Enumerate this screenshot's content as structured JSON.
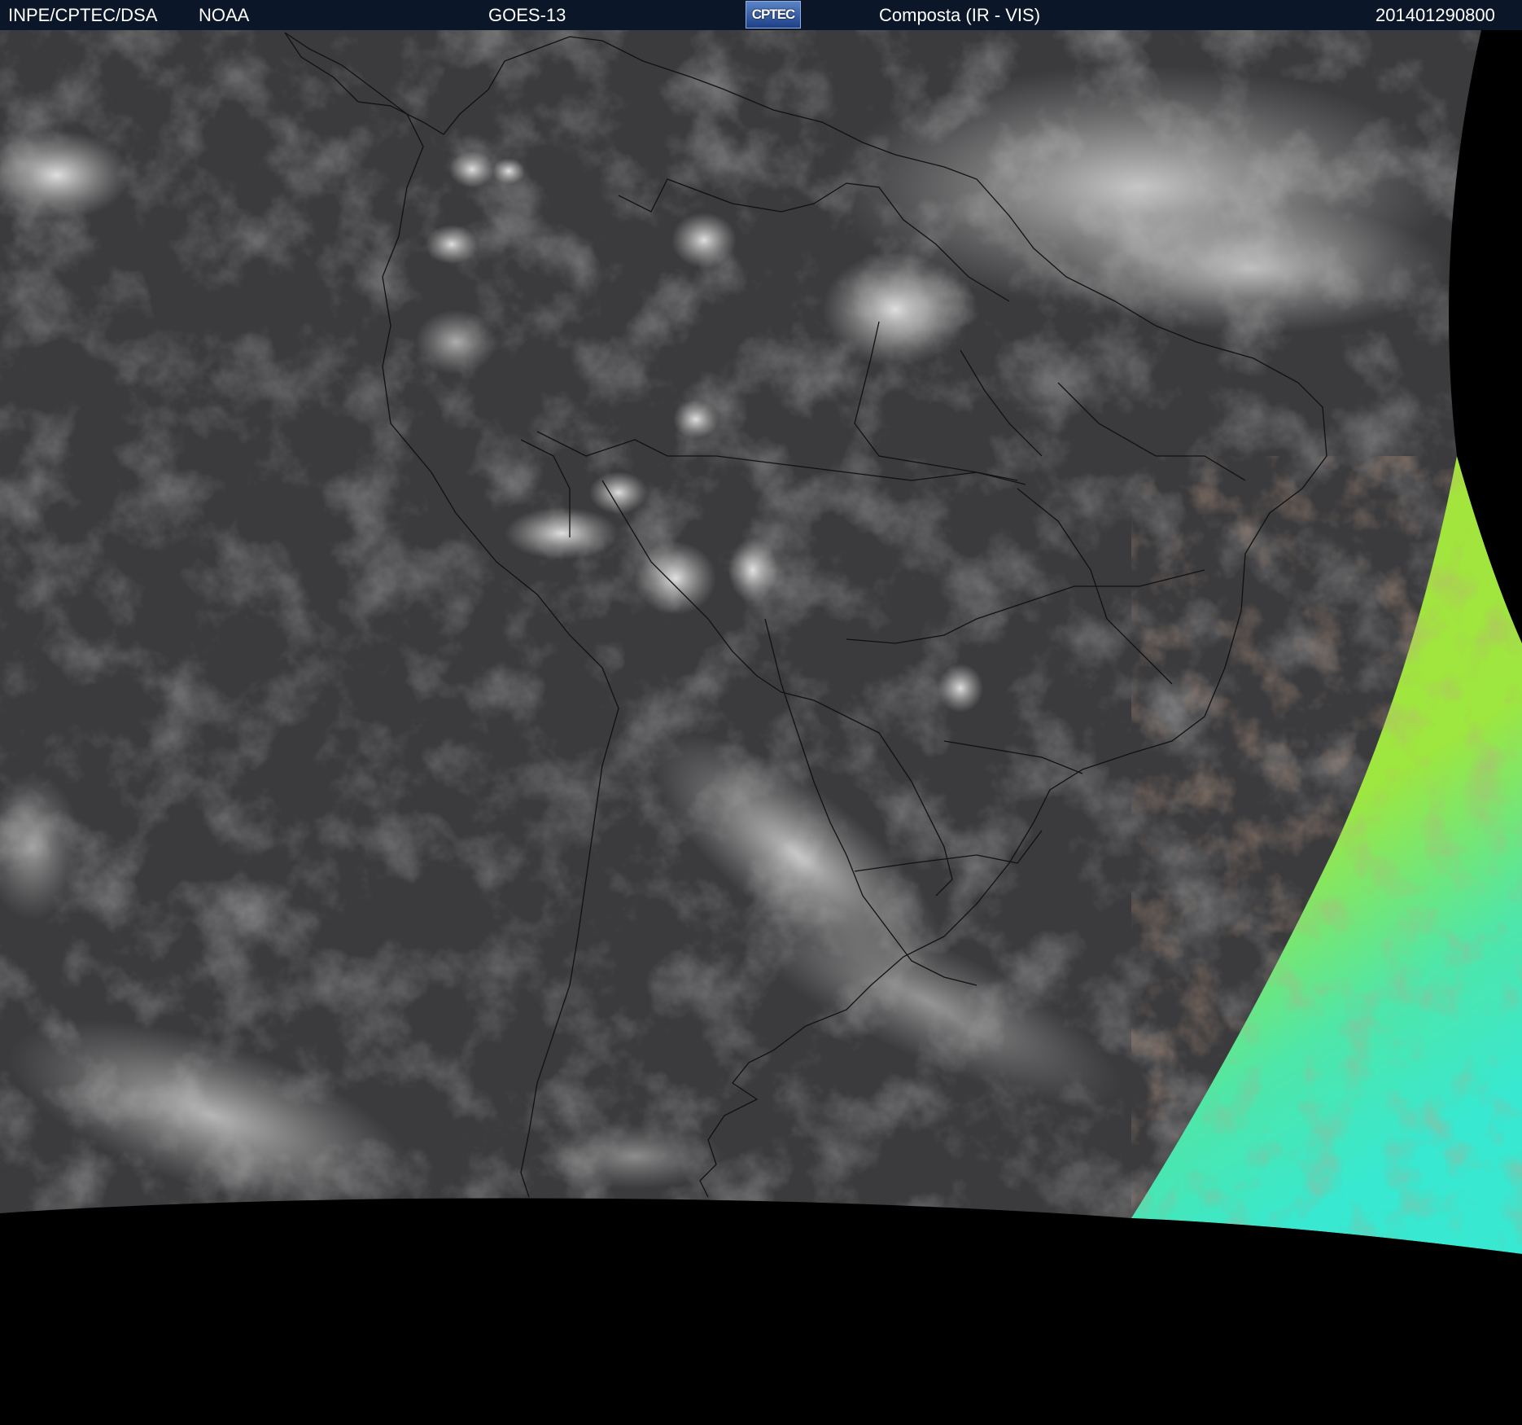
{
  "header": {
    "agency": "INPE/CPTEC/DSA",
    "partner": "NOAA",
    "satellite": "GOES-13",
    "logo_text": "CPTEC",
    "product": "Composta (IR - VIS)",
    "timestamp": "201401290800"
  },
  "colors": {
    "header_bg": "#0b1628",
    "cloud_field": "#3a3a3a",
    "cloud_bright": "#cfcfcf",
    "night_ir_green": "#a6e83a",
    "night_ir_cyan": "#3de8c8",
    "space": "#000000"
  },
  "icons": {
    "logo": "cptec-logo-icon"
  }
}
